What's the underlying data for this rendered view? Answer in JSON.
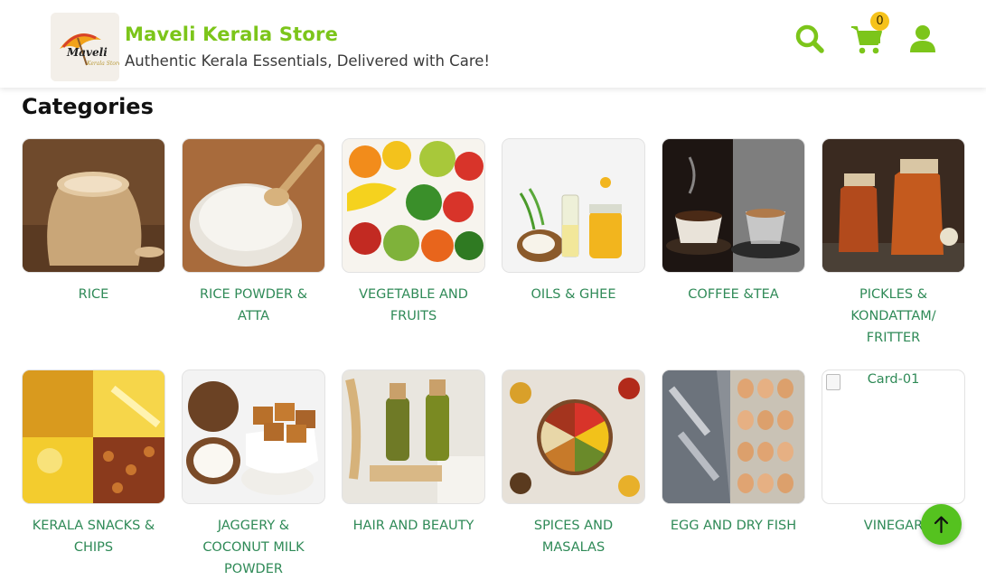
{
  "header": {
    "brand_title": "Maveli Kerala Store",
    "brand_tagline": "Authentic Kerala Essentials, Delivered with Care!",
    "logo_text": "Maveli",
    "cart_count": "0",
    "icons": [
      "search-icon",
      "cart-icon",
      "user-icon"
    ],
    "accent_color": "#7cc51a"
  },
  "section": {
    "title": "Categories"
  },
  "categories": [
    {
      "label": "Rice"
    },
    {
      "label": "Rice Powder & Atta"
    },
    {
      "label": "Vegetable and Fruits"
    },
    {
      "label": "Oils & Ghee"
    },
    {
      "label": "Coffee &Tea"
    },
    {
      "label": "Pickles & Kondattam/ Fritter"
    },
    {
      "label": "Kerala Snacks & Chips"
    },
    {
      "label": "Jaggery & Coconut Milk Powder"
    },
    {
      "label": "Hair and Beauty"
    },
    {
      "label": "Spices and Masalas"
    },
    {
      "label": "Egg and Dry Fish"
    },
    {
      "label": "Vinegar",
      "image_alt": "Card-01"
    }
  ],
  "colors": {
    "label_green": "#2f8a57",
    "button_green": "#55c21f",
    "badge_yellow": "#f6c21a"
  }
}
